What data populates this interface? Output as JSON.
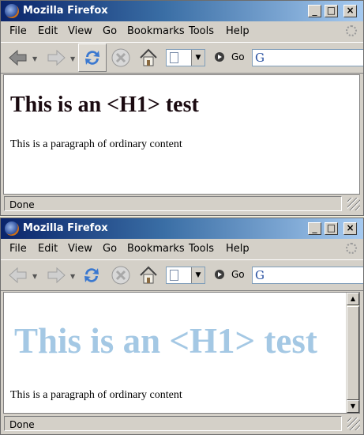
{
  "windows": [
    {
      "title": "Mozilla Firefox",
      "menu": [
        "File",
        "Edit",
        "View",
        "Go",
        "Bookmarks",
        "Tools",
        "Help"
      ],
      "go_label": "Go",
      "heading": "This is an <H1> test",
      "paragraph": "This is a paragraph of ordinary content",
      "status": "Done",
      "heading_color": "#1a0a10"
    },
    {
      "title": "Mozilla Firefox",
      "menu": [
        "File",
        "Edit",
        "View",
        "Go",
        "Bookmarks",
        "Tools",
        "Help"
      ],
      "go_label": "Go",
      "heading": "This is an <H1> test",
      "paragraph": "This is a paragraph of ordinary content",
      "status": "Done",
      "heading_color": "#a4c8e4"
    }
  ],
  "icons": {
    "back": "back-arrow-icon",
    "forward": "forward-arrow-icon",
    "reload": "reload-icon",
    "stop": "stop-icon",
    "home": "home-icon",
    "go": "go-arrow-icon",
    "search_engine": "google-icon",
    "throbber": "throbber-icon"
  },
  "search_engine_letter": "G"
}
